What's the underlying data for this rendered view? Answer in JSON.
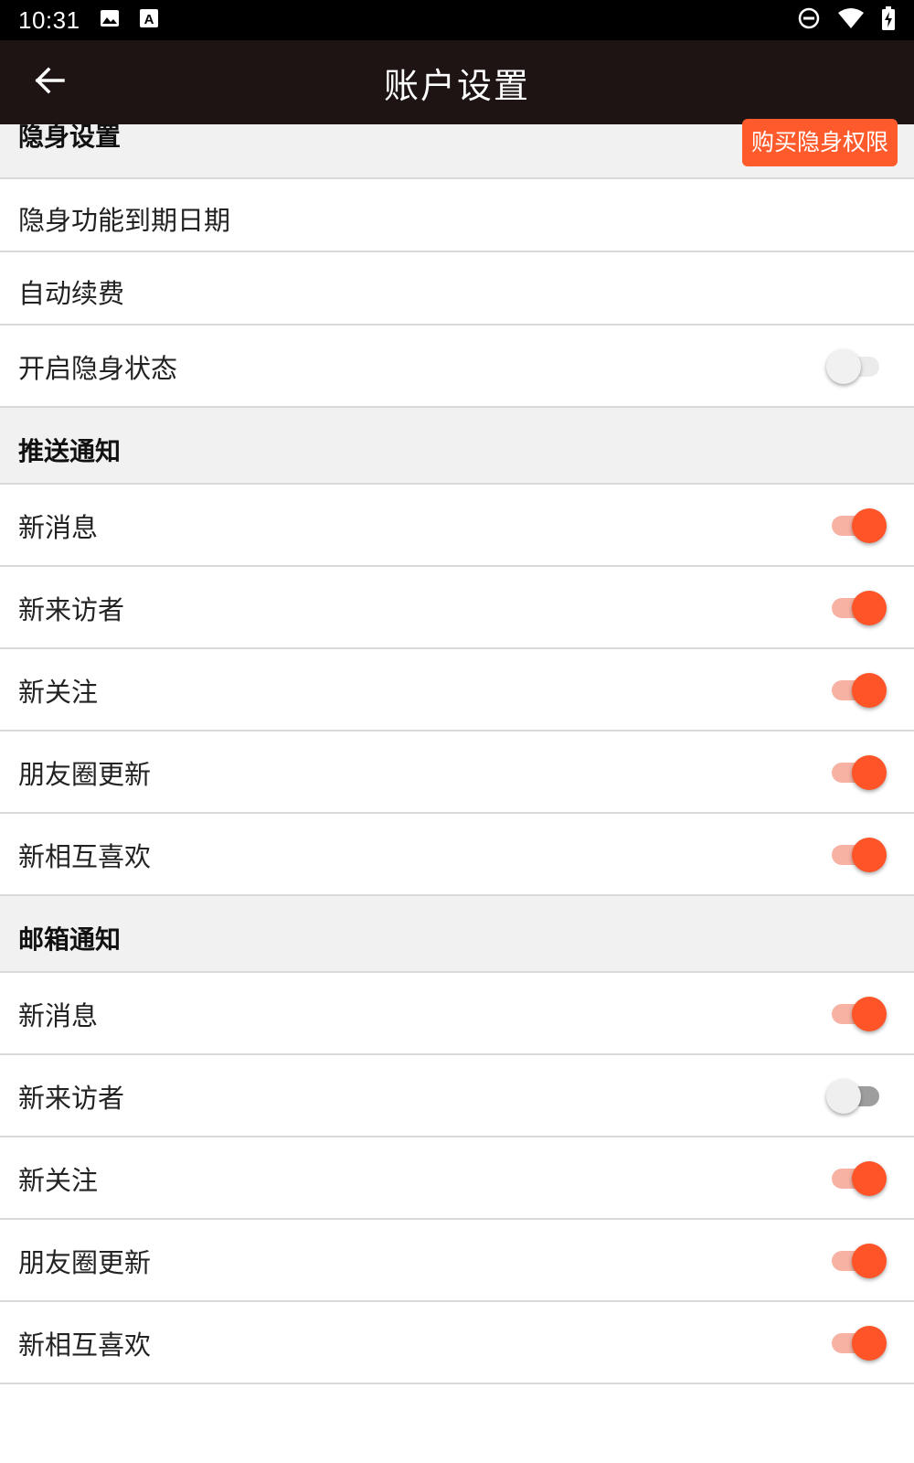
{
  "status_bar": {
    "time": "10:31",
    "icons": [
      "image-icon",
      "font-a-icon",
      "do-not-disturb-icon",
      "wifi-icon",
      "battery-charging-icon"
    ]
  },
  "app_bar": {
    "title": "账户设置",
    "back_icon": "arrow-left-icon"
  },
  "stealth": {
    "header": "隐身设置",
    "buy_button": "购买隐身权限",
    "expiry_label": "隐身功能到期日期",
    "auto_renew_label": "自动续费",
    "enable_label": "开启隐身状态",
    "enable_on": false
  },
  "push": {
    "header": "推送通知",
    "items": [
      {
        "label": "新消息",
        "on": true
      },
      {
        "label": "新来访者",
        "on": true
      },
      {
        "label": "新关注",
        "on": true
      },
      {
        "label": "朋友圈更新",
        "on": true
      },
      {
        "label": "新相互喜欢",
        "on": true
      }
    ]
  },
  "email": {
    "header": "邮箱通知",
    "items": [
      {
        "label": "新消息",
        "on": true
      },
      {
        "label": "新来访者",
        "on": false
      },
      {
        "label": "新关注",
        "on": true
      },
      {
        "label": "朋友圈更新",
        "on": true
      },
      {
        "label": "新相互喜欢",
        "on": true
      }
    ]
  },
  "colors": {
    "accent": "#fe5428",
    "app_bar": "#1e1414",
    "section_bg": "#f1f1f1"
  }
}
